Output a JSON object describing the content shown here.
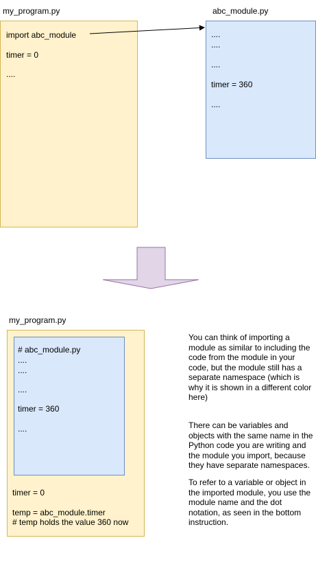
{
  "colors": {
    "program_fill": "#fff2cc",
    "program_border": "#d6b656",
    "module_fill": "#dae8fc",
    "module_border": "#6c8ebf",
    "arrow_fill": "#e1d5e7",
    "arrow_border": "#9673a6"
  },
  "top": {
    "program_label": "my_program.py",
    "program_lines": [
      "import abc_module",
      "timer = 0",
      "...."
    ],
    "module_label": "abc_module.py",
    "module_lines": [
      "....",
      "....",
      "....",
      "timer = 360",
      "...."
    ]
  },
  "bottom": {
    "program_label": "my_program.py",
    "embedded_lines": [
      "# abc_module.py",
      "....",
      "....",
      "....",
      "timer = 360",
      "...."
    ],
    "program_lines": [
      "timer = 0",
      "temp = abc_module.timer",
      "# temp holds the value 360 now"
    ]
  },
  "notes": [
    "You can think of importing a module as similar to including the code from the module in your code, but the module still has a separate namespace (which is why it is shown in a different color here)",
    "There can be variables and objects with the same name in the Python code you are writing and the module you import, because they have separate namespaces.",
    "To refer to a variable or object in the imported module, you use the module name and the dot notation, as seen in the bottom instruction."
  ]
}
